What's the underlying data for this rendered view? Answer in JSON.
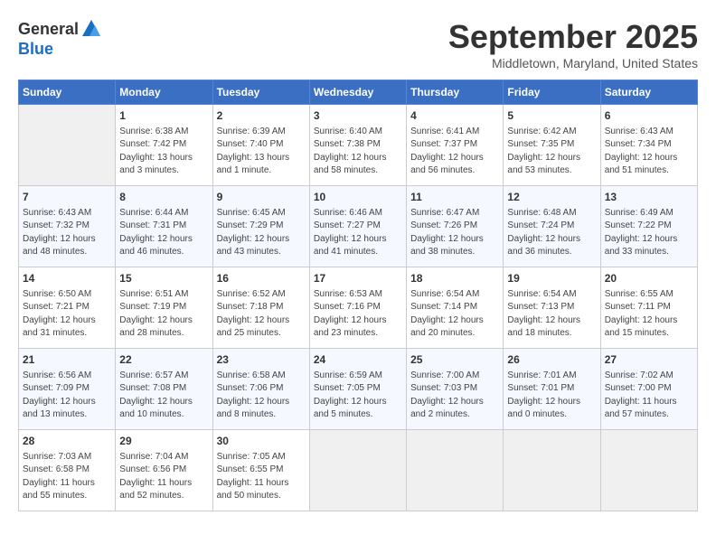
{
  "header": {
    "logo_general": "General",
    "logo_blue": "Blue",
    "month_title": "September 2025",
    "location": "Middletown, Maryland, United States"
  },
  "days_of_week": [
    "Sunday",
    "Monday",
    "Tuesday",
    "Wednesday",
    "Thursday",
    "Friday",
    "Saturday"
  ],
  "weeks": [
    [
      {
        "day": "",
        "info": ""
      },
      {
        "day": "1",
        "info": "Sunrise: 6:38 AM\nSunset: 7:42 PM\nDaylight: 13 hours\nand 3 minutes."
      },
      {
        "day": "2",
        "info": "Sunrise: 6:39 AM\nSunset: 7:40 PM\nDaylight: 13 hours\nand 1 minute."
      },
      {
        "day": "3",
        "info": "Sunrise: 6:40 AM\nSunset: 7:38 PM\nDaylight: 12 hours\nand 58 minutes."
      },
      {
        "day": "4",
        "info": "Sunrise: 6:41 AM\nSunset: 7:37 PM\nDaylight: 12 hours\nand 56 minutes."
      },
      {
        "day": "5",
        "info": "Sunrise: 6:42 AM\nSunset: 7:35 PM\nDaylight: 12 hours\nand 53 minutes."
      },
      {
        "day": "6",
        "info": "Sunrise: 6:43 AM\nSunset: 7:34 PM\nDaylight: 12 hours\nand 51 minutes."
      }
    ],
    [
      {
        "day": "7",
        "info": "Sunrise: 6:43 AM\nSunset: 7:32 PM\nDaylight: 12 hours\nand 48 minutes."
      },
      {
        "day": "8",
        "info": "Sunrise: 6:44 AM\nSunset: 7:31 PM\nDaylight: 12 hours\nand 46 minutes."
      },
      {
        "day": "9",
        "info": "Sunrise: 6:45 AM\nSunset: 7:29 PM\nDaylight: 12 hours\nand 43 minutes."
      },
      {
        "day": "10",
        "info": "Sunrise: 6:46 AM\nSunset: 7:27 PM\nDaylight: 12 hours\nand 41 minutes."
      },
      {
        "day": "11",
        "info": "Sunrise: 6:47 AM\nSunset: 7:26 PM\nDaylight: 12 hours\nand 38 minutes."
      },
      {
        "day": "12",
        "info": "Sunrise: 6:48 AM\nSunset: 7:24 PM\nDaylight: 12 hours\nand 36 minutes."
      },
      {
        "day": "13",
        "info": "Sunrise: 6:49 AM\nSunset: 7:22 PM\nDaylight: 12 hours\nand 33 minutes."
      }
    ],
    [
      {
        "day": "14",
        "info": "Sunrise: 6:50 AM\nSunset: 7:21 PM\nDaylight: 12 hours\nand 31 minutes."
      },
      {
        "day": "15",
        "info": "Sunrise: 6:51 AM\nSunset: 7:19 PM\nDaylight: 12 hours\nand 28 minutes."
      },
      {
        "day": "16",
        "info": "Sunrise: 6:52 AM\nSunset: 7:18 PM\nDaylight: 12 hours\nand 25 minutes."
      },
      {
        "day": "17",
        "info": "Sunrise: 6:53 AM\nSunset: 7:16 PM\nDaylight: 12 hours\nand 23 minutes."
      },
      {
        "day": "18",
        "info": "Sunrise: 6:54 AM\nSunset: 7:14 PM\nDaylight: 12 hours\nand 20 minutes."
      },
      {
        "day": "19",
        "info": "Sunrise: 6:54 AM\nSunset: 7:13 PM\nDaylight: 12 hours\nand 18 minutes."
      },
      {
        "day": "20",
        "info": "Sunrise: 6:55 AM\nSunset: 7:11 PM\nDaylight: 12 hours\nand 15 minutes."
      }
    ],
    [
      {
        "day": "21",
        "info": "Sunrise: 6:56 AM\nSunset: 7:09 PM\nDaylight: 12 hours\nand 13 minutes."
      },
      {
        "day": "22",
        "info": "Sunrise: 6:57 AM\nSunset: 7:08 PM\nDaylight: 12 hours\nand 10 minutes."
      },
      {
        "day": "23",
        "info": "Sunrise: 6:58 AM\nSunset: 7:06 PM\nDaylight: 12 hours\nand 8 minutes."
      },
      {
        "day": "24",
        "info": "Sunrise: 6:59 AM\nSunset: 7:05 PM\nDaylight: 12 hours\nand 5 minutes."
      },
      {
        "day": "25",
        "info": "Sunrise: 7:00 AM\nSunset: 7:03 PM\nDaylight: 12 hours\nand 2 minutes."
      },
      {
        "day": "26",
        "info": "Sunrise: 7:01 AM\nSunset: 7:01 PM\nDaylight: 12 hours\nand 0 minutes."
      },
      {
        "day": "27",
        "info": "Sunrise: 7:02 AM\nSunset: 7:00 PM\nDaylight: 11 hours\nand 57 minutes."
      }
    ],
    [
      {
        "day": "28",
        "info": "Sunrise: 7:03 AM\nSunset: 6:58 PM\nDaylight: 11 hours\nand 55 minutes."
      },
      {
        "day": "29",
        "info": "Sunrise: 7:04 AM\nSunset: 6:56 PM\nDaylight: 11 hours\nand 52 minutes."
      },
      {
        "day": "30",
        "info": "Sunrise: 7:05 AM\nSunset: 6:55 PM\nDaylight: 11 hours\nand 50 minutes."
      },
      {
        "day": "",
        "info": ""
      },
      {
        "day": "",
        "info": ""
      },
      {
        "day": "",
        "info": ""
      },
      {
        "day": "",
        "info": ""
      }
    ]
  ]
}
